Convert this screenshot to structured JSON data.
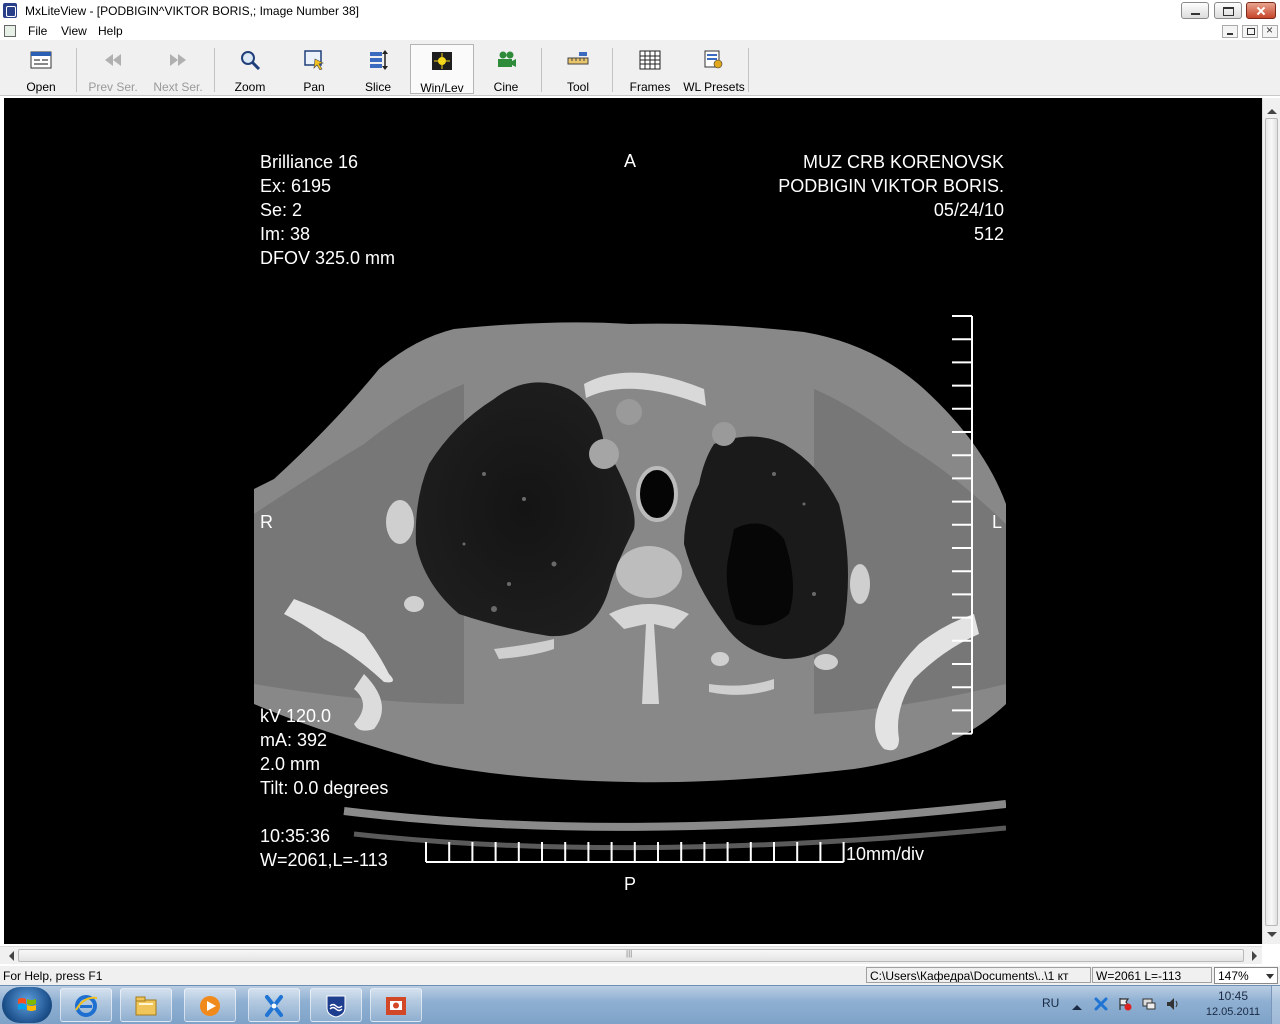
{
  "window": {
    "title": "MxLiteView - [PODBIGIN^VIKTOR BORIS,; Image Number 38]"
  },
  "menu": {
    "items": [
      "File",
      "View",
      "Help"
    ]
  },
  "toolbar": {
    "buttons": [
      {
        "label": "Open",
        "icon": "open-icon",
        "enabled": true
      },
      {
        "label": "Prev Ser.",
        "icon": "prev-series-icon",
        "enabled": false
      },
      {
        "label": "Next Ser.",
        "icon": "next-series-icon",
        "enabled": false
      },
      {
        "label": "Zoom",
        "icon": "zoom-icon",
        "enabled": true
      },
      {
        "label": "Pan",
        "icon": "pan-icon",
        "enabled": true
      },
      {
        "label": "Slice",
        "icon": "slice-icon",
        "enabled": true
      },
      {
        "label": "Win/Lev",
        "icon": "window-level-icon",
        "enabled": true,
        "active": true
      },
      {
        "label": "Cine",
        "icon": "cine-icon",
        "enabled": true
      },
      {
        "label": "Tool",
        "icon": "tool-icon",
        "enabled": true
      },
      {
        "label": "Frames",
        "icon": "frames-icon",
        "enabled": true
      },
      {
        "label": "WL Presets",
        "icon": "wl-presets-icon",
        "enabled": true
      }
    ]
  },
  "viewer": {
    "overlay_top_left": [
      "Brilliance 16",
      "Ex: 6195",
      "Se: 2",
      "Im: 38",
      "DFOV 325.0 mm"
    ],
    "overlay_top_right": [
      "MUZ CRB KORENOVSK",
      "PODBIGIN VIKTOR BORIS.",
      "05/24/10",
      "512"
    ],
    "overlay_bottom_left": [
      "kV 120.0",
      "mA:  392",
      "2.0 mm",
      "Tilt: 0.0 degrees",
      "",
      "10:35:36",
      "W=2061,L=-113"
    ],
    "markers": {
      "anterior": "A",
      "posterior": "P",
      "right": "R",
      "left": "L"
    },
    "scale_label": "10mm/div",
    "vertical_ruler_ticks": 19,
    "horizontal_ruler_ticks": 19
  },
  "statusbar": {
    "help": "For Help, press F1",
    "path": "C:\\Users\\Кафедра\\Documents\\..\\1 кт",
    "wl": "W=2061 L=-113",
    "zoom": "147%"
  },
  "taskbar": {
    "apps": [
      "internet-explorer",
      "file-explorer",
      "media-player",
      "mxliteview",
      "philips-viewer",
      "powerpoint"
    ],
    "tray": {
      "lang": "RU",
      "time": "10:45",
      "date": "12.05.2011"
    }
  },
  "colors": {
    "viewer_background": "#000000",
    "overlay_text": "#ffffff",
    "taskbar": "#8fb0d2"
  }
}
